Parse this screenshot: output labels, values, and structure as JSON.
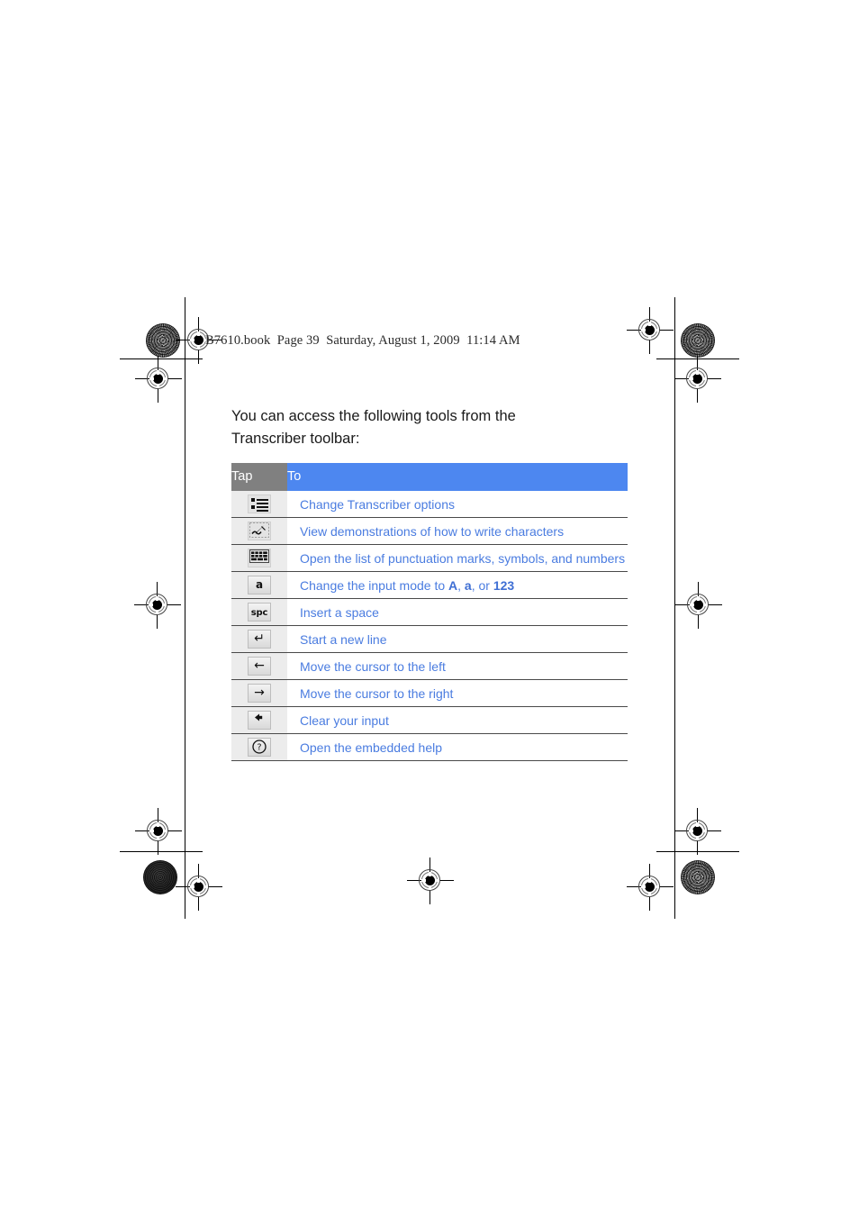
{
  "page": {
    "header_line": "B7610.book  Page 39  Saturday, August 1, 2009  11:14 AM",
    "book_file": "B7610.book",
    "page_label": "Page 39",
    "timestamp": "Saturday, August 1, 2009  11:14 AM"
  },
  "colors": {
    "link_blue": "#4a7ce0",
    "header_blue": "#4d87f0",
    "header_gray": "#808080",
    "icon_cell_gray": "#ececec",
    "rule": "#4a4a4a"
  },
  "main": {
    "intro": "You can access the following tools from the Transcriber toolbar:",
    "table": {
      "columns": [
        "Tap",
        "To"
      ],
      "rows": [
        {
          "icon": "list-options-icon",
          "desc_prefix": "Change Transcriber options",
          "desc_parts": []
        },
        {
          "icon": "write-demo-pen-icon",
          "desc_prefix": "View demonstrations of how to write characters",
          "desc_parts": []
        },
        {
          "icon": "keyboard-grid-icon",
          "desc_prefix": "Open the list of punctuation marks, symbols, and numbers",
          "desc_parts": []
        },
        {
          "icon": "input-mode-a-icon",
          "desc_prefix": "Change the input mode to ",
          "desc_parts": [
            "A",
            ", ",
            "a",
            ", or ",
            "123"
          ]
        },
        {
          "icon": "space-key-icon",
          "desc_prefix": "Insert a space",
          "desc_parts": []
        },
        {
          "icon": "enter-return-icon",
          "desc_prefix": "Start a new line",
          "desc_parts": []
        },
        {
          "icon": "arrow-left-icon",
          "desc_prefix": "Move the cursor to the left",
          "desc_parts": []
        },
        {
          "icon": "arrow-right-icon",
          "desc_prefix": "Move the cursor to the right",
          "desc_parts": []
        },
        {
          "icon": "backspace-clear-icon",
          "desc_prefix": "Clear your input",
          "desc_parts": []
        },
        {
          "icon": "help-question-icon",
          "desc_prefix": "Open the embedded help",
          "desc_parts": []
        }
      ],
      "icon_labels": {
        "input_mode_a": "a",
        "space_key": "spc",
        "enter_return": "↵",
        "arrow_left": "←",
        "arrow_right": "→",
        "backspace_clear": "◆",
        "help_question": "?"
      }
    }
  }
}
